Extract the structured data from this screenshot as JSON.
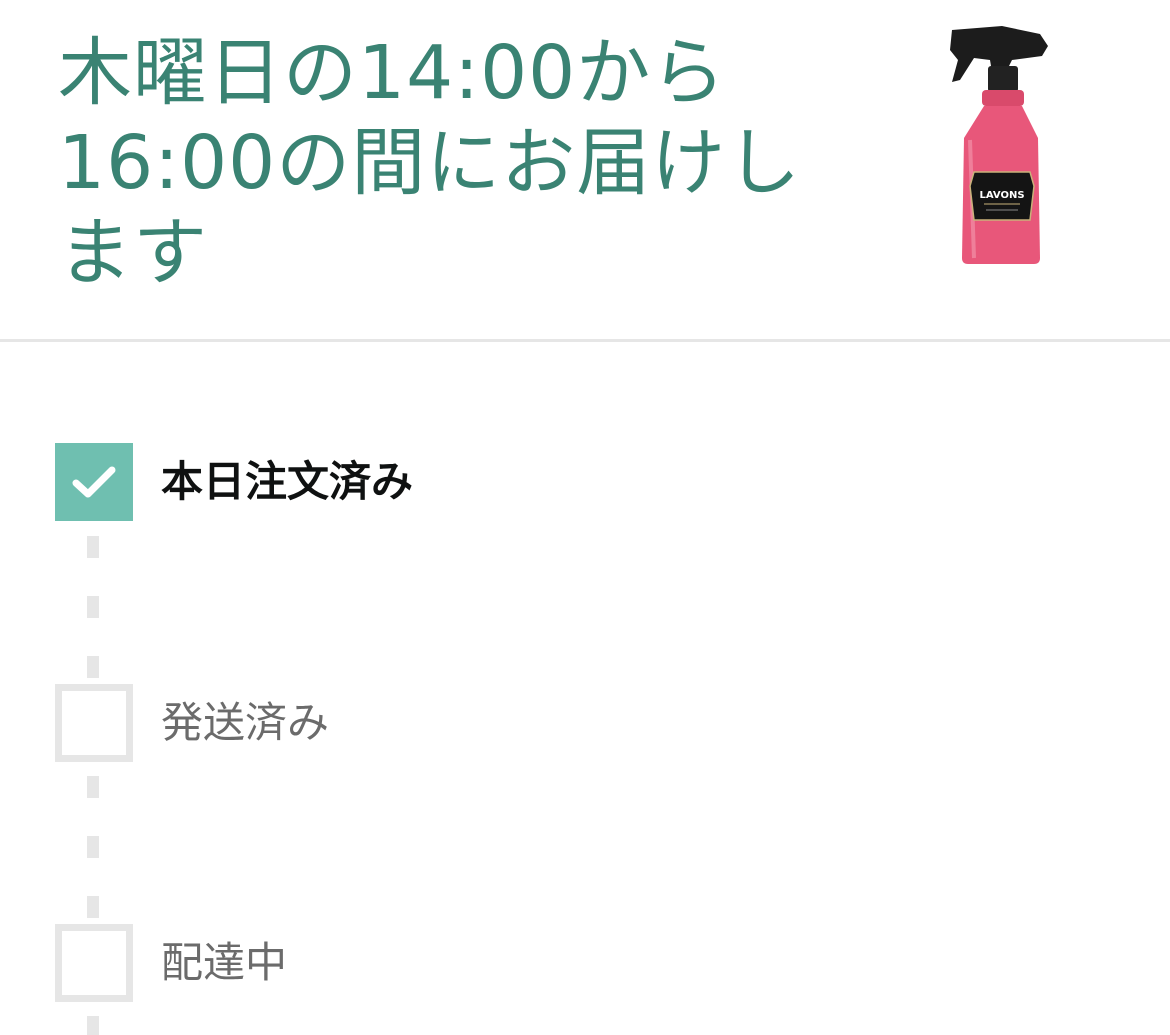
{
  "delivery": {
    "message": "木曜日の14:00から16:00の間にお届けします"
  },
  "product": {
    "image_name": "product-spray-bottle",
    "brand_text": "LAVONS",
    "colors": {
      "bottle": "#e8577a",
      "cap": "#1a1a1a",
      "label": "#111111"
    }
  },
  "tracker": {
    "steps": [
      {
        "label": "本日注文済み",
        "status": "done"
      },
      {
        "label": "発送済み",
        "status": "pending"
      },
      {
        "label": "配達中",
        "status": "pending"
      }
    ]
  },
  "colors": {
    "title": "#3a8373",
    "done_box": "#6fbfb0",
    "pending_border": "#e6e6e6",
    "divider": "#e6e6e6"
  },
  "icons": {
    "check": "checkmark-icon"
  }
}
